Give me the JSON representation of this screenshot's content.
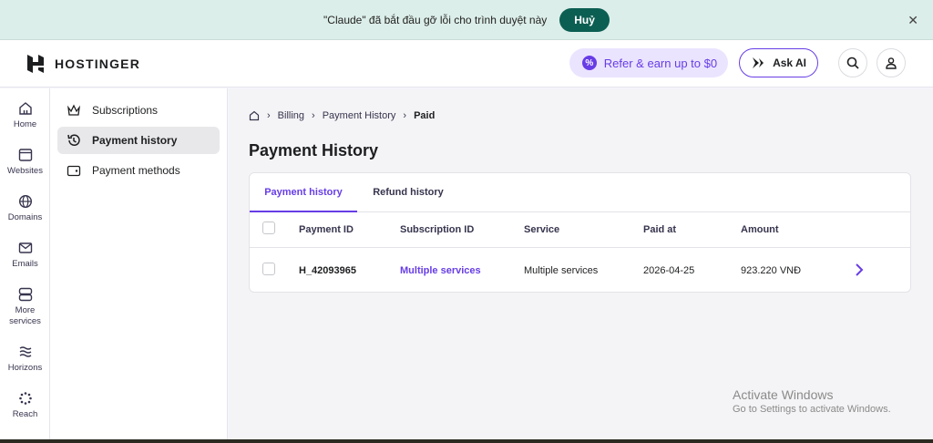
{
  "debug_banner": {
    "message": "\"Claude\" đã bắt đầu gỡ lỗi cho trình duyệt này",
    "cancel_label": "Huỷ",
    "close_icon": "close-icon"
  },
  "header": {
    "brand": "HOSTINGER",
    "refer_label": "Refer & earn up to $0",
    "ask_ai_label": "Ask AI",
    "accent_color": "#673de6"
  },
  "icon_nav": {
    "items": [
      {
        "label": "Home",
        "icon": "home-icon"
      },
      {
        "label": "Websites",
        "icon": "websites-icon"
      },
      {
        "label": "Domains",
        "icon": "globe-icon"
      },
      {
        "label": "Emails",
        "icon": "mail-icon"
      },
      {
        "label": "More services",
        "icon": "services-icon"
      },
      {
        "label": "Horizons",
        "icon": "horizons-icon"
      },
      {
        "label": "Reach",
        "icon": "reach-icon"
      }
    ]
  },
  "sub_nav": {
    "items": [
      {
        "label": "Subscriptions",
        "icon": "crown-icon"
      },
      {
        "label": "Payment history",
        "icon": "history-icon",
        "active": true
      },
      {
        "label": "Payment methods",
        "icon": "wallet-icon"
      }
    ]
  },
  "breadcrumb": {
    "items": [
      "Billing",
      "Payment History"
    ],
    "current": "Paid"
  },
  "page": {
    "title": "Payment History"
  },
  "tabs": [
    {
      "label": "Payment history",
      "active": true
    },
    {
      "label": "Refund history",
      "active": false
    }
  ],
  "table": {
    "columns": [
      "Payment ID",
      "Subscription ID",
      "Service",
      "Paid at",
      "Amount"
    ],
    "rows": [
      {
        "payment_id": "H_42093965",
        "subscription_id": "Multiple services",
        "service": "Multiple services",
        "paid_at": "2026-04-25",
        "amount": "923.220 VNĐ"
      }
    ]
  },
  "watermark": {
    "title": "Activate Windows",
    "subtitle": "Go to Settings to activate Windows."
  }
}
